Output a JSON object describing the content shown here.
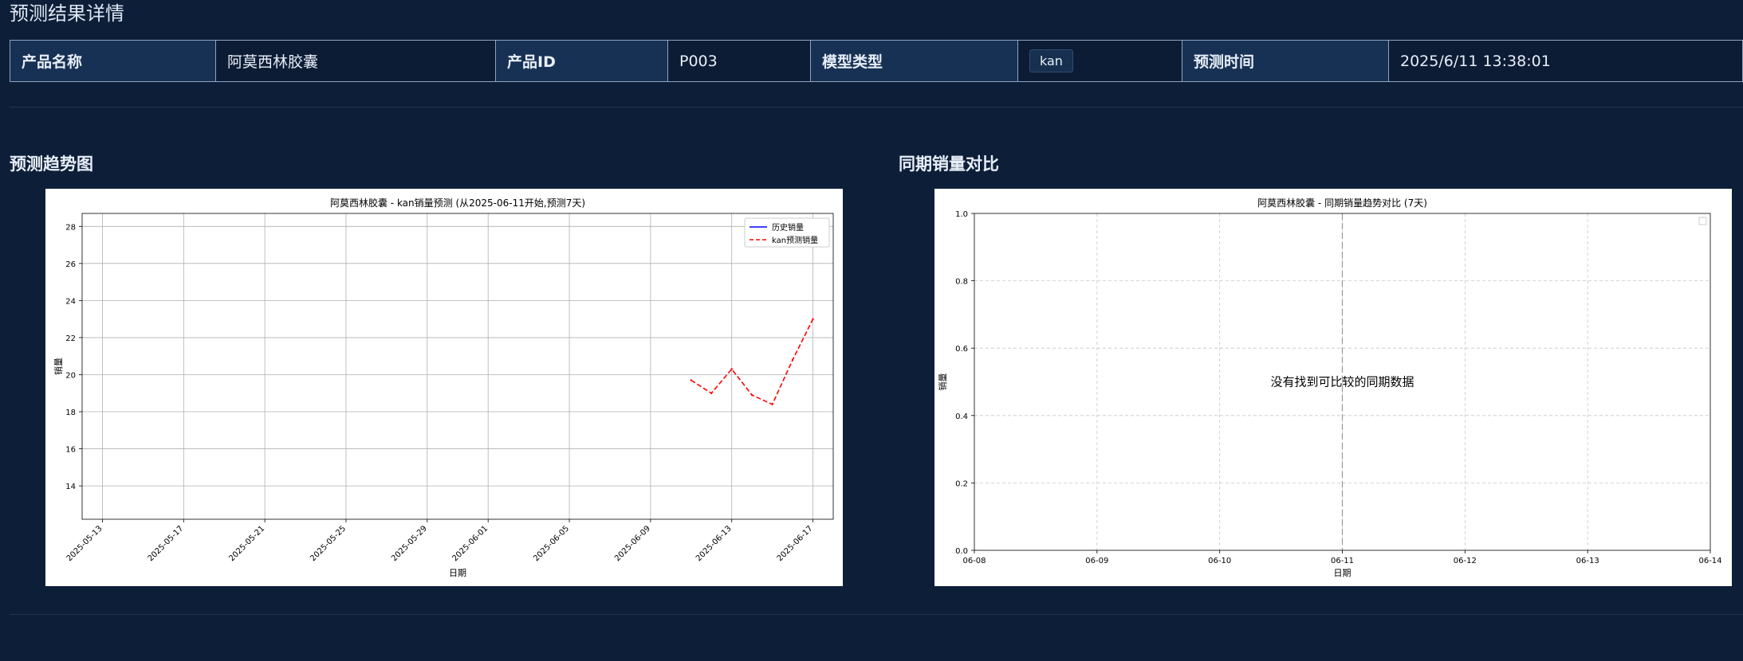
{
  "page": {
    "title": "预测结果详情"
  },
  "info": {
    "product_name_label": "产品名称",
    "product_name": "阿莫西林胶囊",
    "product_id_label": "产品ID",
    "product_id": "P003",
    "model_type_label": "模型类型",
    "model_type": "kan",
    "predict_time_label": "预测时间",
    "predict_time": "2025/6/11 13:38:01"
  },
  "sections": {
    "trend_title": "预测趋势图",
    "compare_title": "同期销量对比"
  },
  "chart_data": [
    {
      "type": "line",
      "title": "阿莫西林胶囊 - kan销量预测 (从2025-06-11开始,预测7天)",
      "xlabel": "日期",
      "ylabel": "销量",
      "x_ticks": [
        "2025-05-13",
        "2025-05-17",
        "2025-05-21",
        "2025-05-25",
        "2025-05-29",
        "2025-06-01",
        "2025-06-05",
        "2025-06-09",
        "2025-06-13",
        "2025-06-17"
      ],
      "y_ticks": [
        "14",
        "16",
        "18",
        "20",
        "22",
        "24",
        "26",
        "28"
      ],
      "ylim": [
        12.2,
        28.7
      ],
      "grid": true,
      "legend_position": "top-right",
      "series": [
        {
          "name": "历史销量",
          "color": "#0000ff",
          "style": "solid",
          "x": [],
          "y": []
        },
        {
          "name": "kan预测销量",
          "color": "#ff0000",
          "style": "dashed",
          "x": [
            "2025-06-11",
            "2025-06-12",
            "2025-06-13",
            "2025-06-14",
            "2025-06-15",
            "2025-06-16",
            "2025-06-17"
          ],
          "y": [
            19.7,
            19.0,
            20.3,
            18.9,
            18.4,
            20.8,
            23.0
          ]
        }
      ]
    },
    {
      "type": "line",
      "title": "阿莫西林胶囊 - 同期销量趋势对比 (7天)",
      "xlabel": "日期",
      "ylabel": "销量",
      "x_ticks": [
        "06-08",
        "06-09",
        "06-10",
        "06-11",
        "06-12",
        "06-13",
        "06-14"
      ],
      "y_ticks": [
        "0.0",
        "0.2",
        "0.4",
        "0.6",
        "0.8",
        "1.0"
      ],
      "ylim": [
        0,
        1
      ],
      "grid": true,
      "vline_at": "06-11",
      "message": "没有找到可比较的同期数据",
      "series": []
    }
  ]
}
